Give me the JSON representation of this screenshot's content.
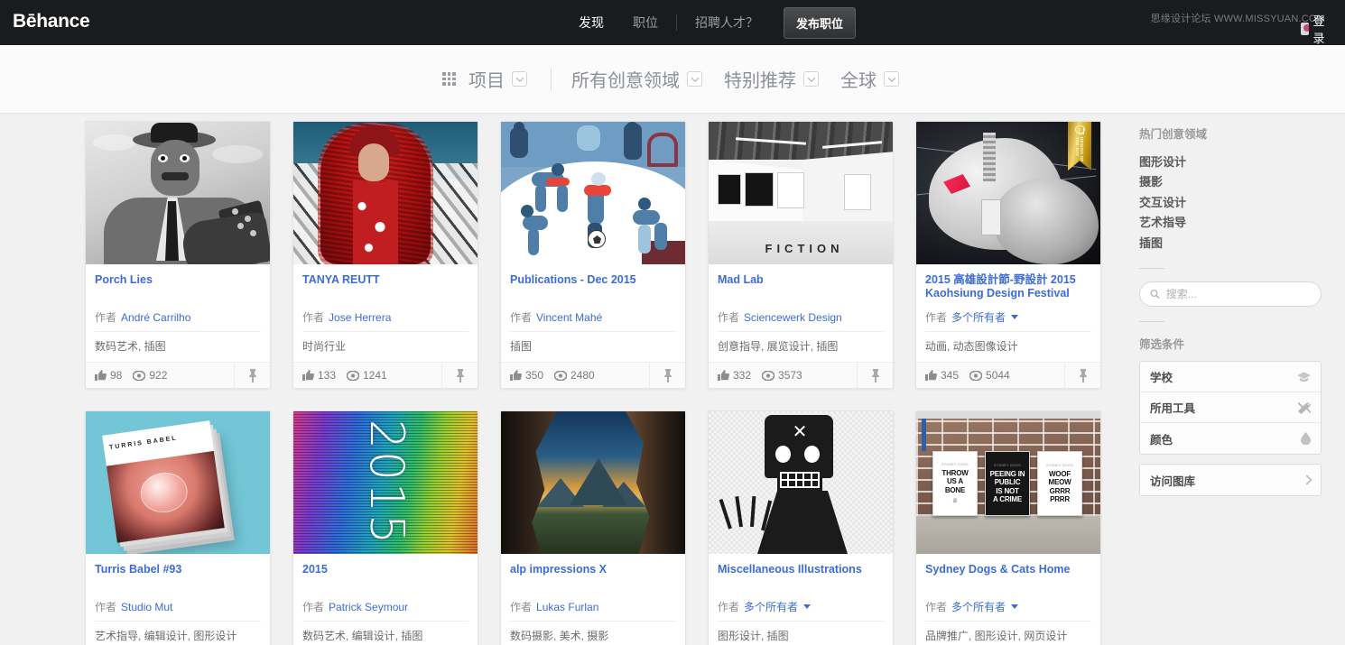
{
  "topnav": {
    "brand": "Bēhance",
    "links": [
      {
        "label": "发现",
        "active": true
      },
      {
        "label": "职位",
        "active": false
      },
      {
        "label": "招聘人才？",
        "active": false
      }
    ],
    "post_button": "发布职位",
    "watermark": "思缘设计论坛 WWW.MISSYUAN.COM",
    "login": "登录"
  },
  "filterbar": {
    "grid_icon": "grid-icon",
    "items": [
      {
        "label": "项目",
        "caret": true
      },
      {
        "label": "所有创意领域",
        "caret": true
      },
      {
        "label": "特别推荐",
        "caret": true
      },
      {
        "label": "全球",
        "caret": true
      }
    ]
  },
  "labels": {
    "owner_prefix": "作者",
    "like_icon": "thumbs-up-icon",
    "view_icon": "eye-icon",
    "pin_icon": "pin-icon"
  },
  "projects": [
    {
      "title": "Porch Lies",
      "owner": "André Carrilho",
      "multi_owner": false,
      "fields": "数码艺术, 插图",
      "likes": "98",
      "views": "922",
      "badge": null
    },
    {
      "title": "TANYA REUTT",
      "owner": "Jose Herrera",
      "multi_owner": false,
      "fields": "时尚行业",
      "likes": "133",
      "views": "1241",
      "badge": null
    },
    {
      "title": "Publications - Dec 2015",
      "owner": "Vincent Mahé",
      "multi_owner": false,
      "fields": "插图",
      "likes": "350",
      "views": "2480",
      "badge": null
    },
    {
      "title": "Mad Lab",
      "owner": "Sciencewerk Design",
      "multi_owner": false,
      "fields": "创意指导, 展览设计, 插图",
      "likes": "332",
      "views": "3573",
      "badge": null
    },
    {
      "title": "2015 高雄設計節-野設計 2015 Kaohsiung Design Festival",
      "owner": "多个所有者",
      "multi_owner": true,
      "fields": "动画, 动态图像设计",
      "likes": "345",
      "views": "5044",
      "badge": "DESIGN OF THE DAY"
    },
    {
      "title": "Turris Babel #93",
      "owner": "Studio Mut",
      "multi_owner": false,
      "fields": "艺术指导, 编辑设计, 图形设计",
      "likes": "",
      "views": "",
      "badge": null
    },
    {
      "title": "2015",
      "owner": "Patrick Seymour",
      "multi_owner": false,
      "fields": "数码艺术, 编辑设计, 插图",
      "likes": "",
      "views": "",
      "badge": null
    },
    {
      "title": "alp impressions X",
      "owner": "Lukas Furlan",
      "multi_owner": false,
      "fields": "数码摄影, 美术, 摄影",
      "likes": "",
      "views": "",
      "badge": null
    },
    {
      "title": "Miscellaneous Illustrations",
      "owner": "多个所有者",
      "multi_owner": true,
      "fields": "图形设计, 插图",
      "likes": "",
      "views": "",
      "badge": null
    },
    {
      "title": "Sydney Dogs & Cats Home",
      "owner": "多个所有者",
      "multi_owner": true,
      "fields": "品牌推广, 图形设计, 网页设计",
      "likes": "",
      "views": "",
      "badge": null
    }
  ],
  "sidebar": {
    "popular_heading": "热门创意领域",
    "popular_links": [
      "图形设计",
      "摄影",
      "交互设计",
      "艺术指导",
      "插图"
    ],
    "search": {
      "placeholder": "搜索...",
      "value": "",
      "icon": "search-icon"
    },
    "filters_heading": "筛选条件",
    "filter_items": [
      {
        "label": "学校",
        "icon": "graduation-cap-icon"
      },
      {
        "label": "所用工具",
        "icon": "tools-icon"
      },
      {
        "label": "颜色",
        "icon": "color-drop-icon"
      }
    ],
    "gallery_item": {
      "label": "访问图库",
      "icon": "chevron-right-icon"
    }
  },
  "thumb_art": {
    "sydney_posters": [
      {
        "caption": "SYDNEY DOGS",
        "lines": [
          "THROW",
          "US A",
          "BONE"
        ],
        "dark": false
      },
      {
        "caption": "SYDNEY DOGS",
        "lines": [
          "PEEING IN",
          "PUBLIC",
          "IS NOT",
          "A CRIME"
        ],
        "dark": true
      },
      {
        "caption": "SYDNEY DOGS",
        "lines": [
          "WOOF",
          "MEOW",
          "GRRR",
          "PRRR"
        ],
        "dark": false
      }
    ],
    "mad_lab_word": "FICTION",
    "turris_cover": "TURRIS BABEL",
    "glitch_text": "2015"
  },
  "colors": {
    "nav_bg": "#191b1d",
    "link_blue": "#3d6bd6",
    "page_bg": "#f1f1f1",
    "card_bg": "#ffffff"
  }
}
